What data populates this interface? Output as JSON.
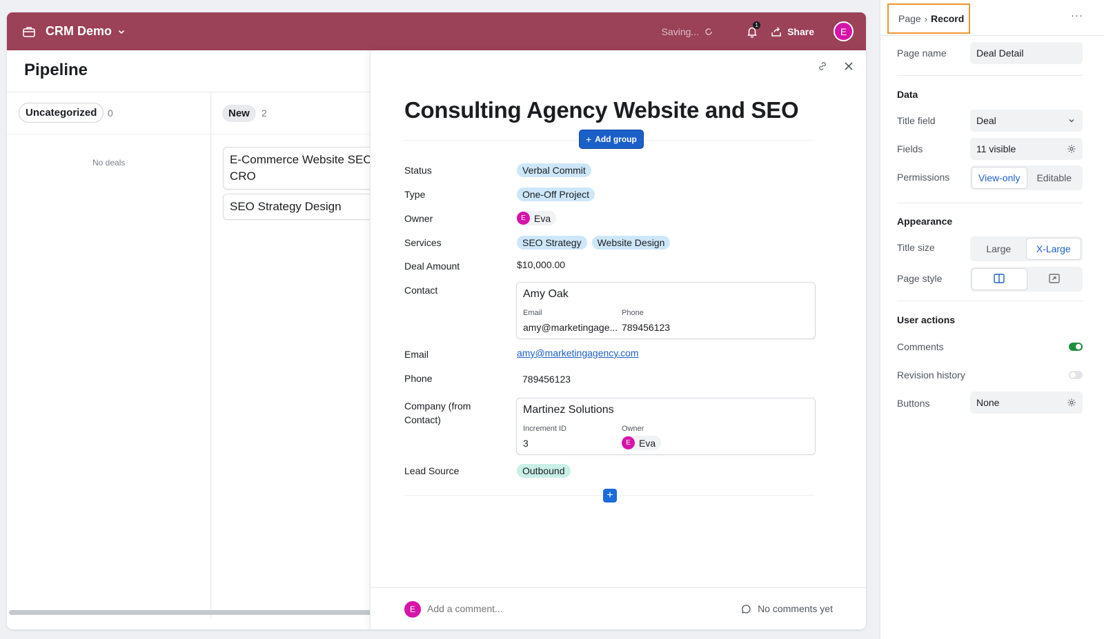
{
  "topbar": {
    "app_name": "CRM Demo",
    "saving_text": "Saving...",
    "notification_count": "1",
    "share_label": "Share",
    "avatar_initial": "E",
    "brand_color": "#9b4158"
  },
  "pipeline": {
    "title": "Pipeline",
    "groups": [
      {
        "label": "Uncategorized",
        "count": "0",
        "empty_text": "No deals"
      },
      {
        "label": "New",
        "count": "2"
      }
    ],
    "cards": [
      "E-Commerce Website SEO CRO",
      "SEO Strategy Design"
    ]
  },
  "record": {
    "title": "Consulting Agency Website and SEO",
    "add_group_label": "Add group",
    "fields": {
      "status": {
        "label": "Status",
        "value": "Verbal Commit"
      },
      "type": {
        "label": "Type",
        "value": "One-Off Project"
      },
      "owner": {
        "label": "Owner",
        "initial": "E",
        "value": "Eva"
      },
      "services": {
        "label": "Services",
        "values": [
          "SEO Strategy",
          "Website Design"
        ]
      },
      "deal_amount": {
        "label": "Deal Amount",
        "value": "$10,000.00"
      },
      "contact": {
        "label": "Contact",
        "name": "Amy Oak",
        "email_label": "Email",
        "email_value": "amy@marketingage...",
        "phone_label": "Phone",
        "phone_value": "789456123"
      },
      "email": {
        "label": "Email",
        "value": "amy@marketingagency.com"
      },
      "phone": {
        "label": "Phone",
        "value": "789456123"
      },
      "company": {
        "label": "Company (from Contact)",
        "name": "Martinez Solutions",
        "increment_label": "Increment ID",
        "increment_value": "3",
        "owner_label": "Owner",
        "owner_initial": "E",
        "owner_value": "Eva"
      },
      "lead_source": {
        "label": "Lead Source",
        "value": "Outbound"
      }
    },
    "comment": {
      "avatar_initial": "E",
      "placeholder": "Add a comment...",
      "empty_text": "No comments yet"
    }
  },
  "props": {
    "breadcrumb": {
      "parent": "Page",
      "current": "Record"
    },
    "more_label": "···",
    "page_name": {
      "label": "Page name",
      "value": "Deal Detail"
    },
    "data_section": "Data",
    "title_field": {
      "label": "Title field",
      "value": "Deal"
    },
    "fields": {
      "label": "Fields",
      "value": "11 visible"
    },
    "permissions": {
      "label": "Permissions",
      "options": [
        "View-only",
        "Editable"
      ],
      "selected": "View-only"
    },
    "appearance_section": "Appearance",
    "title_size": {
      "label": "Title size",
      "options": [
        "Large",
        "X-Large"
      ],
      "selected": "X-Large"
    },
    "page_style": {
      "label": "Page style",
      "selected": "split"
    },
    "user_actions_section": "User actions",
    "comments": {
      "label": "Comments",
      "enabled": true
    },
    "revision_history": {
      "label": "Revision history",
      "enabled": false
    },
    "buttons": {
      "label": "Buttons",
      "value": "None"
    },
    "highlight_color": "#f0942f"
  }
}
